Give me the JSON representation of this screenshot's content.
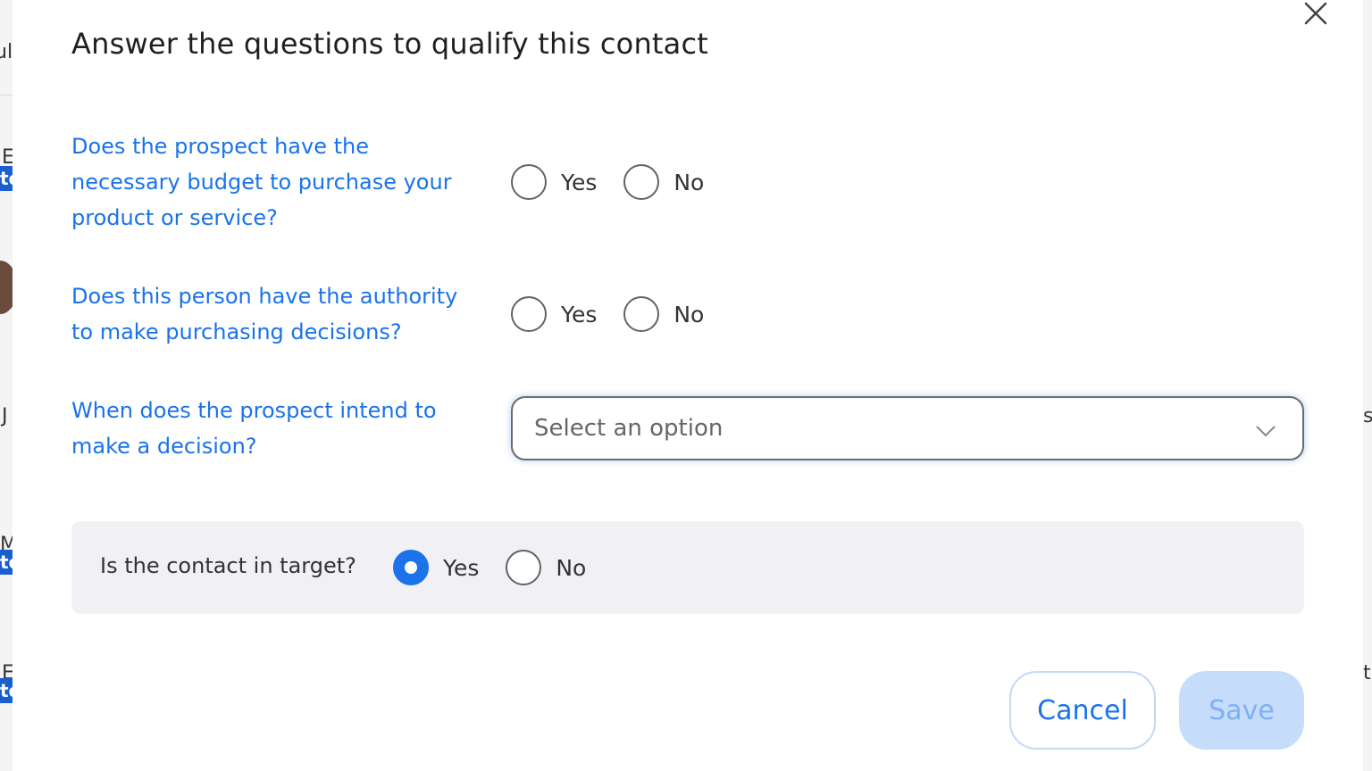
{
  "background": {
    "fragments": [
      "ul",
      "E",
      "J",
      "M",
      "E"
    ],
    "badge_text": "to",
    "right_fragments": [
      "s",
      "t"
    ]
  },
  "modal": {
    "title": "Answer the questions to qualify this contact",
    "close_icon": "close-icon",
    "questions": [
      {
        "text": "Does the prospect have the necessary budget to purchase your product or service?",
        "options": [
          "Yes",
          "No"
        ],
        "selected": null
      },
      {
        "text": "Does this person have the authority to make purchasing decisions?",
        "options": [
          "Yes",
          "No"
        ],
        "selected": null
      },
      {
        "text": "When does the prospect intend to make a decision?",
        "select_placeholder": "Select an option"
      }
    ],
    "target": {
      "label": "Is the contact in target?",
      "options": [
        "Yes",
        "No"
      ],
      "selected": "Yes"
    },
    "cancel_label": "Cancel",
    "save_label": "Save"
  },
  "colors": {
    "accent": "#1a73e8",
    "save_disabled_bg": "#c6dcfb",
    "target_bg": "#f0f0f5"
  }
}
